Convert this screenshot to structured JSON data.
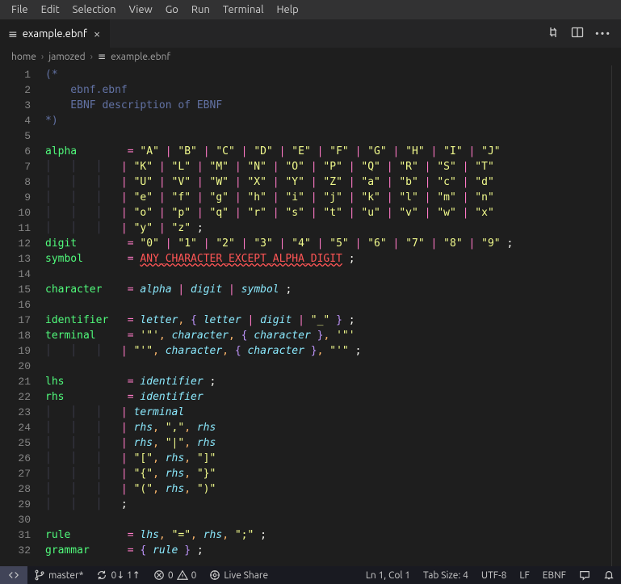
{
  "menu": [
    "File",
    "Edit",
    "Selection",
    "View",
    "Go",
    "Run",
    "Terminal",
    "Help"
  ],
  "tab": {
    "name": "example.ebnf"
  },
  "breadcrumbs": [
    "home",
    "jamozed",
    "example.ebnf"
  ],
  "code": {
    "open": "(*",
    "c1": "ebnf.ebnf",
    "c2": "EBNF description of EBNF",
    "close": "*)",
    "alpha": "alpha",
    "digit": "digit",
    "symbol": "symbol",
    "any": "ANY_CHARACTER_EXCEPT_ALPHA_DIGIT",
    "character": "character",
    "identifier": "identifier",
    "letter": "letter",
    "terminal": "terminal",
    "lhs": "lhs",
    "rhs": "rhs",
    "rule": "rule",
    "grammar": "grammar",
    "alpha_rows": [
      [
        "\"A\"",
        "\"B\"",
        "\"C\"",
        "\"D\"",
        "\"E\"",
        "\"F\"",
        "\"G\"",
        "\"H\"",
        "\"I\"",
        "\"J\""
      ],
      [
        "\"K\"",
        "\"L\"",
        "\"M\"",
        "\"N\"",
        "\"O\"",
        "\"P\"",
        "\"Q\"",
        "\"R\"",
        "\"S\"",
        "\"T\""
      ],
      [
        "\"U\"",
        "\"V\"",
        "\"W\"",
        "\"X\"",
        "\"Y\"",
        "\"Z\"",
        "\"a\"",
        "\"b\"",
        "\"c\"",
        "\"d\""
      ],
      [
        "\"e\"",
        "\"f\"",
        "\"g\"",
        "\"h\"",
        "\"i\"",
        "\"j\"",
        "\"k\"",
        "\"l\"",
        "\"m\"",
        "\"n\""
      ],
      [
        "\"o\"",
        "\"p\"",
        "\"q\"",
        "\"r\"",
        "\"s\"",
        "\"t\"",
        "\"u\"",
        "\"v\"",
        "\"w\"",
        "\"x\""
      ],
      [
        "\"y\"",
        "\"z\""
      ]
    ],
    "digit_row": [
      "\"0\"",
      "\"1\"",
      "\"2\"",
      "\"3\"",
      "\"4\"",
      "\"5\"",
      "\"6\"",
      "\"7\"",
      "\"8\"",
      "\"9\""
    ],
    "underscore": "\"_\"",
    "dq": "'\"'",
    "sq": "\"'\"",
    "comma_lit": "\",\"",
    "pipe_lit": "\"|\"",
    "lb": "\"[\"",
    "rb": "\"]\"",
    "lc": "\"{\"",
    "rc": "\"}\"",
    "lp": "\"(\"",
    "rp": "\")\"",
    "eq_lit": "\"=\"",
    "semi_lit": "\";\""
  },
  "status": {
    "branch": "master*",
    "sync": "0↓ 1↑",
    "err": "0",
    "warn": "0",
    "live": "Live Share",
    "pos": "Ln 1, Col 1",
    "tab": "Tab Size: 4",
    "enc": "UTF-8",
    "eol": "LF",
    "lang": "EBNF"
  }
}
